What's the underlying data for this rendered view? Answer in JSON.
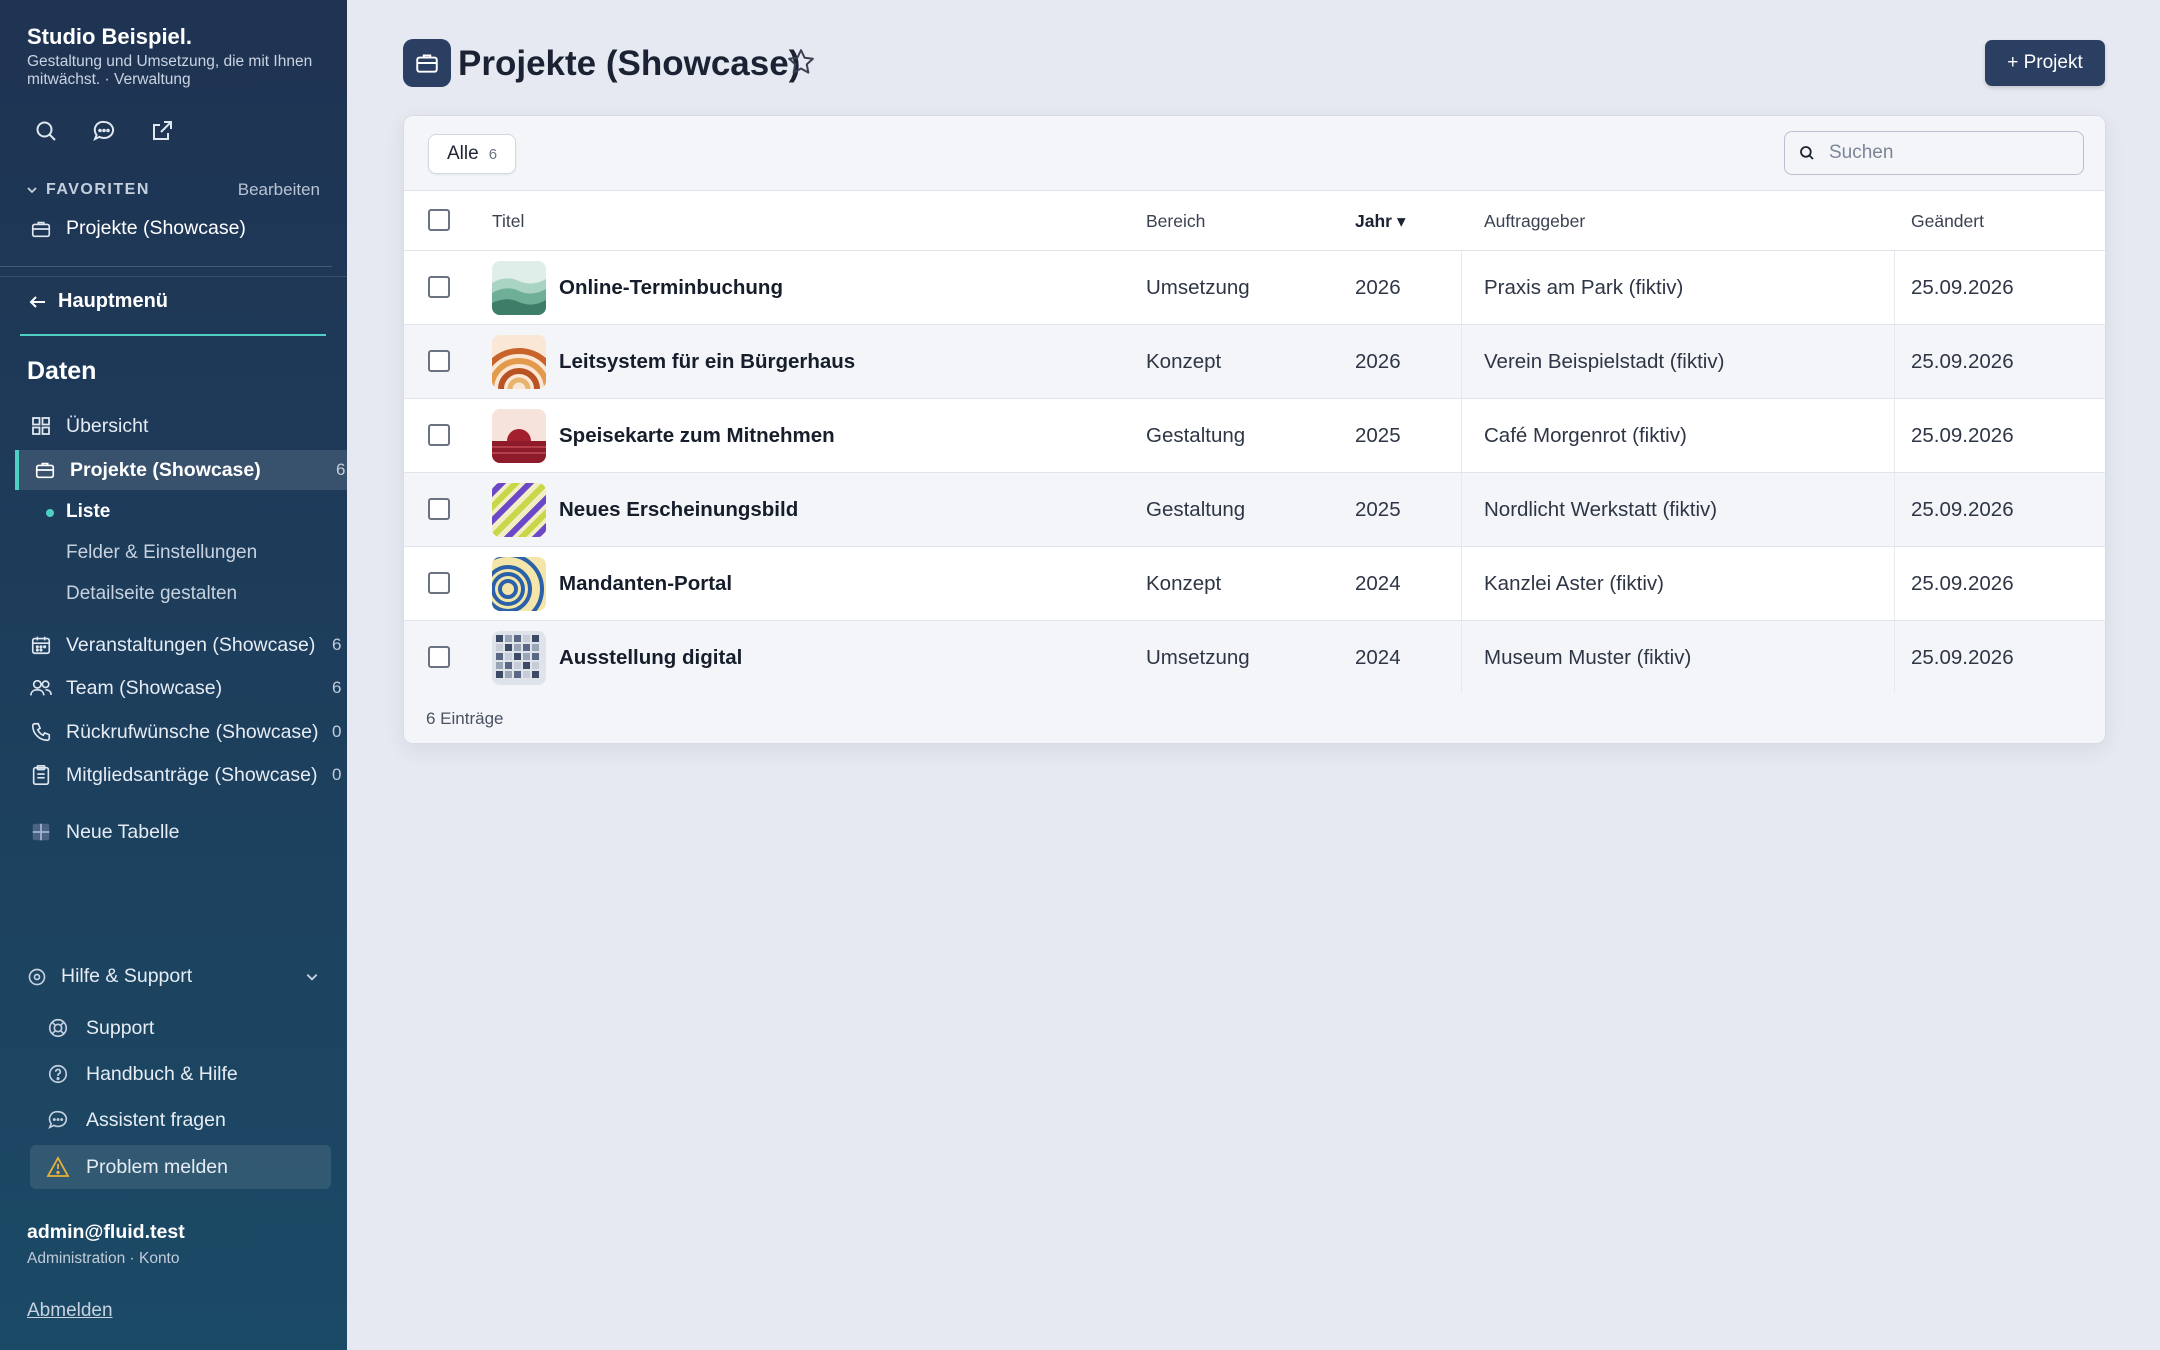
{
  "sidebar": {
    "brand_title": "Studio Beispiel.",
    "brand_subtitle": "Gestaltung und Umsetzung, die mit Ihnen mitwächst. · Verwaltung",
    "top_icons": [
      "search-icon",
      "chat-icon",
      "external-link-icon"
    ],
    "favorites_label": "FAVORITEN",
    "favorites_edit": "Bearbeiten",
    "favorites": [
      {
        "label": "Projekte (Showcase)",
        "icon": "briefcase-icon"
      }
    ],
    "main_menu": "Hauptmenü",
    "section_title": "Daten",
    "items": [
      {
        "label": "Übersicht",
        "icon": "grid-icon",
        "count": ""
      },
      {
        "label": "Projekte (Showcase)",
        "icon": "briefcase-icon",
        "count": "6"
      },
      {
        "label": "Veranstaltungen (Showcase)",
        "icon": "calendar-icon",
        "count": "6"
      },
      {
        "label": "Team (Showcase)",
        "icon": "users-icon",
        "count": "6"
      },
      {
        "label": "Rückrufwünsche (Showcase)",
        "icon": "phone-icon",
        "count": "0"
      },
      {
        "label": "Mitgliedsanträge (Showcase)",
        "icon": "clipboard-icon",
        "count": "0"
      },
      {
        "label": "Neue Tabelle",
        "icon": "table-plus-icon",
        "count": ""
      }
    ],
    "sub_items": [
      "Liste",
      "Felder & Einstellungen",
      "Detailseite gestalten"
    ],
    "help": {
      "title": "Hilfe & Support",
      "items": [
        {
          "label": "Support",
          "icon": "lifebuoy-icon"
        },
        {
          "label": "Handbuch & Hilfe",
          "icon": "question-icon"
        },
        {
          "label": "Assistent fragen",
          "icon": "chat-icon"
        },
        {
          "label": "Problem melden",
          "icon": "warning-icon"
        }
      ]
    },
    "user_email": "admin@fluid.test",
    "user_role": "Administration · Konto",
    "logout": "Abmelden"
  },
  "header": {
    "title": "Projekte (Showcase)",
    "add_button": "+ Projekt"
  },
  "toolbar": {
    "tab_all_label": "Alle",
    "tab_all_count": "6",
    "search_placeholder": "Suchen"
  },
  "table": {
    "columns": {
      "titel": "Titel",
      "bereich": "Bereich",
      "jahr": "Jahr ▾",
      "auftraggeber": "Auftraggeber",
      "geaendert": "Geändert"
    },
    "rows": [
      {
        "titel": "Online-Terminbuchung",
        "bereich": "Umsetzung",
        "jahr": "2026",
        "auftraggeber": "Praxis am Park (fiktiv)",
        "geaendert": "25.09.2026",
        "thumb": "hills"
      },
      {
        "titel": "Leitsystem für ein Bürgerhaus",
        "bereich": "Konzept",
        "jahr": "2026",
        "auftraggeber": "Verein Beispielstadt (fiktiv)",
        "geaendert": "25.09.2026",
        "thumb": "rainbow"
      },
      {
        "titel": "Speisekarte zum Mitnehmen",
        "bereich": "Gestaltung",
        "jahr": "2025",
        "auftraggeber": "Café Morgenrot (fiktiv)",
        "geaendert": "25.09.2026",
        "thumb": "sunset"
      },
      {
        "titel": "Neues Erscheinungsbild",
        "bereich": "Gestaltung",
        "jahr": "2025",
        "auftraggeber": "Nordlicht Werkstatt (fiktiv)",
        "geaendert": "25.09.2026",
        "thumb": "stripes"
      },
      {
        "titel": "Mandanten-Portal",
        "bereich": "Konzept",
        "jahr": "2024",
        "auftraggeber": "Kanzlei Aster (fiktiv)",
        "geaendert": "25.09.2026",
        "thumb": "rings"
      },
      {
        "titel": "Ausstellung digital",
        "bereich": "Umsetzung",
        "jahr": "2024",
        "auftraggeber": "Museum Muster (fiktiv)",
        "geaendert": "25.09.2026",
        "thumb": "mosaic"
      }
    ],
    "footer": "6 Einträge"
  },
  "colors": {
    "accent": "#4ed0c4",
    "primary": "#2a3f62",
    "warning": "#e8b13a"
  }
}
